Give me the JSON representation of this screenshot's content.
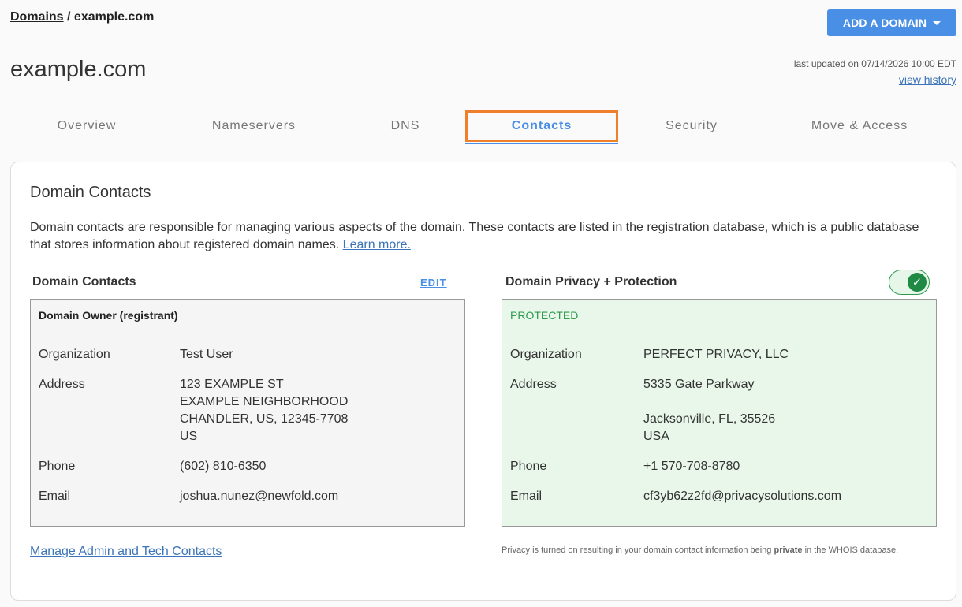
{
  "breadcrumb": {
    "root": "Domains",
    "separator": " / ",
    "current": "example.com"
  },
  "header": {
    "add_domain_label": "ADD A DOMAIN",
    "title": "example.com",
    "last_updated": "last updated on 07/14/2026 10:00 EDT",
    "view_history": "view history"
  },
  "tabs": [
    {
      "label": "Overview"
    },
    {
      "label": "Nameservers"
    },
    {
      "label": "DNS"
    },
    {
      "label": "Contacts",
      "active": true
    },
    {
      "label": "Security"
    },
    {
      "label": "Move & Access"
    }
  ],
  "card": {
    "title": "Domain Contacts",
    "description": "Domain contacts are responsible for managing various aspects of the domain. These contacts are listed in the registration database, which is a public database that stores information about registered domain names.",
    "learn_more": "Learn more."
  },
  "contacts": {
    "heading": "Domain Contacts",
    "edit_label": "EDIT",
    "box_title": "Domain Owner (registrant)",
    "organization_label": "Organization",
    "organization": "Test User",
    "address_label": "Address",
    "address_line1": "123 EXAMPLE ST",
    "address_line2": "EXAMPLE NEIGHBORHOOD",
    "address_line3": "CHANDLER, US, 12345-7708",
    "address_line4": "US",
    "phone_label": "Phone",
    "phone": "(602) 810-6350",
    "email_label": "Email",
    "email": "joshua.nunez@newfold.com",
    "manage_link": "Manage Admin and Tech Contacts"
  },
  "privacy": {
    "heading": "Domain Privacy + Protection",
    "toggle_on": true,
    "status": "PROTECTED",
    "organization_label": "Organization",
    "organization": "PERFECT PRIVACY, LLC",
    "address_label": "Address",
    "address_line1": "5335 Gate Parkway",
    "address_line2": "Jacksonville, FL, 35526",
    "address_line3": "USA",
    "phone_label": "Phone",
    "phone": "+1 570-708-8780",
    "email_label": "Email",
    "email": "cf3yb62z2fd@privacysolutions.com",
    "note_before": "Privacy is turned on resulting in your domain contact information being ",
    "note_bold": "private",
    "note_after": " in the WHOIS database."
  },
  "colors": {
    "accent": "#4a8fe6",
    "tab_highlight": "#f07f2c",
    "protected_green": "#2f9a4e"
  }
}
